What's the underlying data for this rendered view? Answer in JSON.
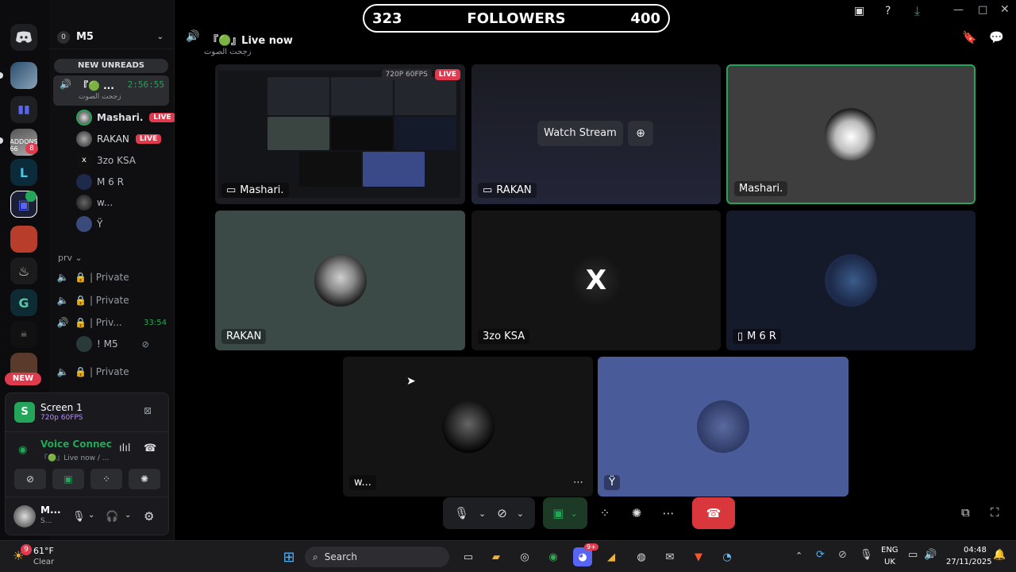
{
  "banner": {
    "left_count": "323",
    "title": "FOLLOWERS",
    "right_count": "400"
  },
  "server": {
    "name": "M5",
    "badge": "0"
  },
  "channel_header": {
    "title": "『🟢』Live now",
    "subtitle": "زجحت الصوت"
  },
  "new_unreads": "NEW UNREADS",
  "active_channel": {
    "name": "『🟢 ...",
    "timer": "2:56:55",
    "subtitle": "زجحت الصوت"
  },
  "members": [
    {
      "name": "Mashari.",
      "live": "LIVE"
    },
    {
      "name": "RAKAN",
      "live": "LIVE"
    },
    {
      "name": "3zo KSA",
      "live": ""
    },
    {
      "name": "M 6 R",
      "live": ""
    },
    {
      "name": "w...",
      "live": ""
    },
    {
      "name": "Ÿ",
      "live": ""
    }
  ],
  "category": "prv",
  "private_channels": [
    {
      "name": "| Private",
      "timer": ""
    },
    {
      "name": "| Private",
      "timer": ""
    },
    {
      "name": "| Priv...",
      "timer": "33:54"
    },
    {
      "name": "| Private",
      "timer": ""
    },
    {
      "name": "| Private",
      "timer": ""
    }
  ],
  "private_member": "! M5",
  "guild_badges": {
    "addons_count": "8",
    "new_label": "NEW",
    "addons_text": "ADDONS 66"
  },
  "screen_panel": {
    "title": "Screen 1",
    "quality": "720p 60FPS"
  },
  "voice_panel": {
    "status": "Voice Connected",
    "channel": "『🟢』Live now / ..."
  },
  "user_panel": {
    "name": "M...",
    "status": "S..."
  },
  "tiles": [
    {
      "name": "Mashari.",
      "overlay": "720P 60FPS",
      "live": "LIVE"
    },
    {
      "name": "RAKAN",
      "watch": "Watch Stream"
    },
    {
      "name": "Mashari."
    },
    {
      "name": "RAKAN"
    },
    {
      "name": "3zo KSA"
    },
    {
      "name": "M 6 R"
    },
    {
      "name": "w..."
    },
    {
      "name": "Ÿ"
    }
  ],
  "taskbar": {
    "weather_temp": "61°F",
    "weather_desc": "Clear",
    "weather_badge": "9",
    "search": "Search",
    "lang": "ENG",
    "region": "UK",
    "time": "04:48",
    "date": "27/11/2025",
    "discord_badge": "9+"
  },
  "colors": {
    "accent_green": "#23a55a",
    "live_red": "#e03a4e",
    "end_call": "#da373c"
  }
}
